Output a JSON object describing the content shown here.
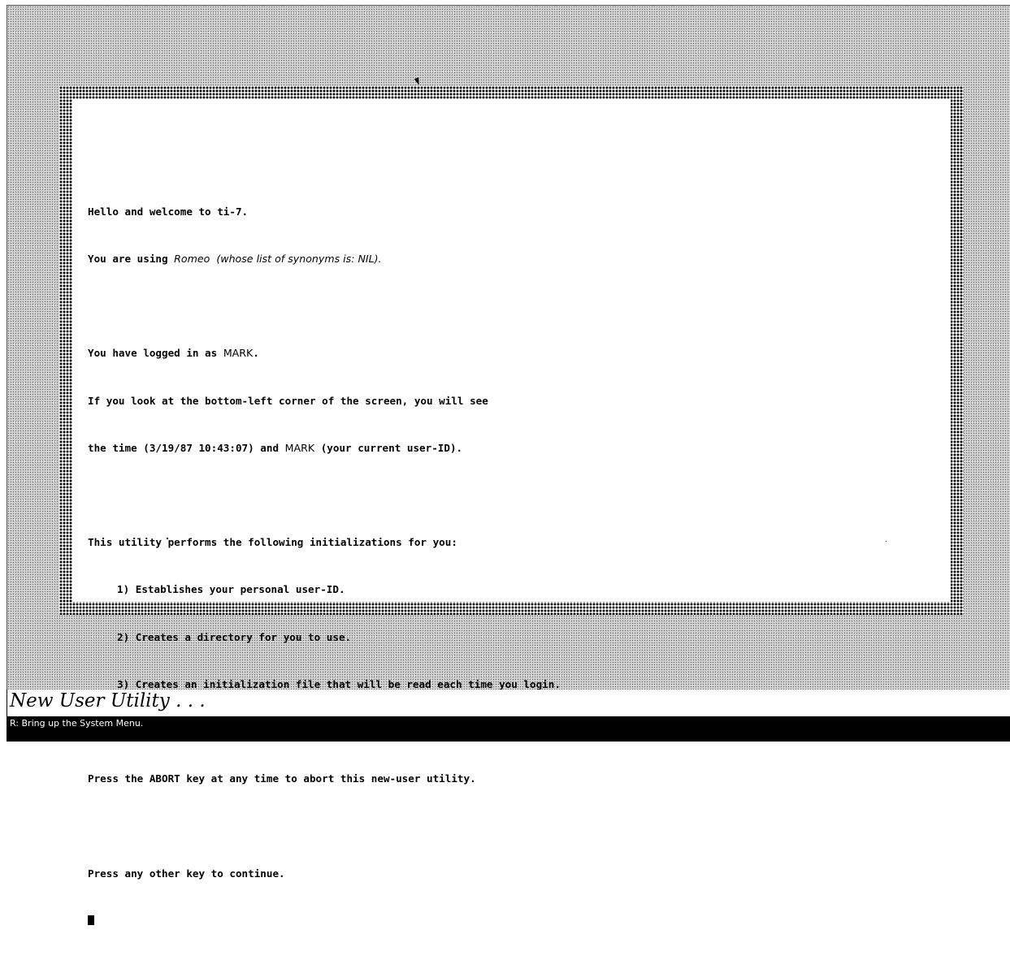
{
  "window": {
    "lines": {
      "l1": "Hello and welcome to ti-7.",
      "l2_prefix": "You are using ",
      "l2_machine": "Romeo",
      "l2_synonyms": "  (whose list of synonyms is: NIL).",
      "l3_prefix": "You have logged in as ",
      "l3_user": "MARK",
      "l3_suffix": ".",
      "l4": "If you look at the bottom-left corner of the screen, you will see",
      "l5_prefix": "the time (3/19/87 10:43:07) and ",
      "l5_user": "MARK",
      "l5_suffix": " (your current user-ID).",
      "l6": "This utility performs the following initializations for you:",
      "l7": "1) Establishes your personal user-ID.",
      "l8": "2) Creates a directory for you to use.",
      "l9": "3) Creates an initialization file that will be read each time you login.",
      "l10": "Press the ABORT key at any time to abort this new-user utility.",
      "l11": "Press any other key to continue."
    }
  },
  "doc_line": {
    "title": "New User Utility . . ."
  },
  "status_bar": {
    "text": "R: Bring up the System Menu."
  },
  "icons": {
    "pointer": "mouse-pointer-icon",
    "cursor": "text-cursor"
  }
}
